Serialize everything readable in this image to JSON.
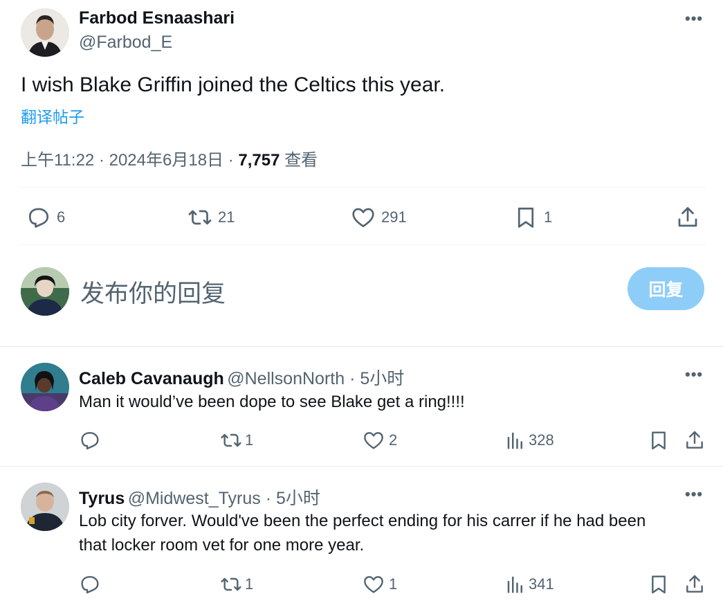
{
  "main_tweet": {
    "author_name": "Farbod Esnaashari",
    "author_handle": "@Farbod_E",
    "more": "•••",
    "text": "I wish Blake Griffin joined the Celtics this year.",
    "translate": "翻译帖子",
    "time": "上午11:22 · 2024年6月18日 · ",
    "views_count": "7,757",
    "views_label": " 查看",
    "actions": {
      "replies": "6",
      "retweets": "21",
      "likes": "291",
      "bookmarks": "1"
    }
  },
  "compose": {
    "placeholder": "发布你的回复",
    "button_label": "回复"
  },
  "replies": [
    {
      "name": "Caleb Cavanaugh",
      "handle": "@NellsonNorth · 5小时",
      "text": "Man it would’ve been dope to see Blake get a ring!!!!",
      "replies": "",
      "retweets": "1",
      "likes": "2",
      "views": "328"
    },
    {
      "name": "Tyrus",
      "handle": "@Midwest_Tyrus · 5小时",
      "text_line1": "Lob city forver. Would've been the perfect ending for his carrer if he had been",
      "text_line2": "that locker room vet for one more year.",
      "replies": "",
      "retweets": "1",
      "likes": "1",
      "views": "341"
    }
  ],
  "colors": {
    "primary_text": "#0f1419",
    "secondary_text": "#536471",
    "link": "#1d9bf0",
    "reply_button_disabled": "#8ecdf8",
    "divider": "#eff3f4"
  }
}
